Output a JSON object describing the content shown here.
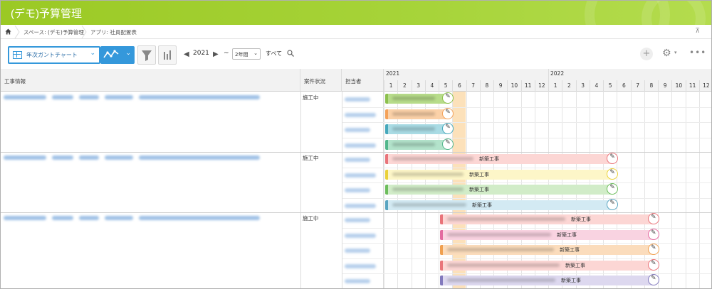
{
  "app": {
    "title": "(デモ)予算管理"
  },
  "breadcrumb": {
    "space": "スペース: (デモ)予算管理",
    "app": "アプリ: 社員配置表"
  },
  "toolbar": {
    "view": "年次ガントチャート",
    "year": "2021",
    "span": "2年間",
    "all_label": "すべて"
  },
  "columns": {
    "work_info": "工事情報",
    "status": "案件状況",
    "person": "担当者"
  },
  "gantt": {
    "years": [
      "2021",
      "2022"
    ],
    "months": [
      "1",
      "2",
      "3",
      "4",
      "5",
      "6",
      "7",
      "8",
      "9",
      "10",
      "11",
      "12",
      "1",
      "2",
      "3",
      "4",
      "5",
      "6",
      "7",
      "8",
      "9",
      "10",
      "11",
      "12"
    ],
    "bar_label": "新築工事"
  },
  "groups": [
    {
      "status": "施工中"
    },
    {
      "status": "施工中"
    },
    {
      "status": "施工中"
    }
  ],
  "colors": {
    "header_green": "#9bc924",
    "accent_blue": "#3498db",
    "today": "#fac882"
  }
}
